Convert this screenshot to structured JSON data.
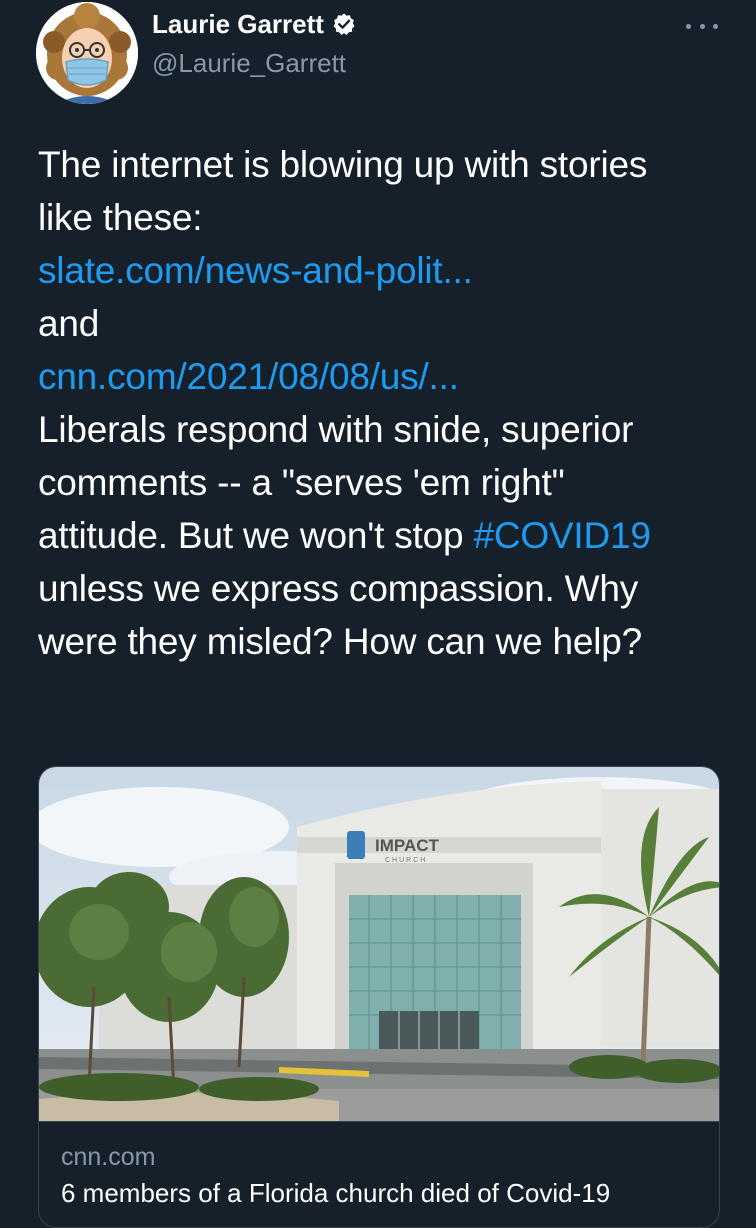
{
  "author": {
    "display_name": "Laurie Garrett",
    "handle": "@Laurie_Garrett",
    "verified_icon": "verified-badge-icon",
    "avatar_icon": "avatar-illustration"
  },
  "more_icon": "more-dots-icon",
  "tweet": {
    "line1": "The internet is blowing up with stories",
    "line2": "like these:",
    "link1": "slate.com/news-and-polit...",
    "line4": "and",
    "link2": "cnn.com/2021/08/08/us/...",
    "line6": "Liberals respond with snide, superior",
    "line7": "comments -- a \"serves 'em right\"",
    "line8_text": "attitude. But we won't stop ",
    "hashtag": "#COVID19",
    "line9": "unless we express compassion. Why",
    "line10": "were they misled? How can we help?"
  },
  "card": {
    "image_sign": "IMPACT",
    "image_sign_sub": "CHURCH",
    "domain": "cnn.com",
    "title": "6 members of a Florida church died of Covid-19"
  },
  "colors": {
    "background": "#15202b",
    "link": "#1d9bf0",
    "secondary_text": "#8899a6",
    "border": "#38444d"
  }
}
